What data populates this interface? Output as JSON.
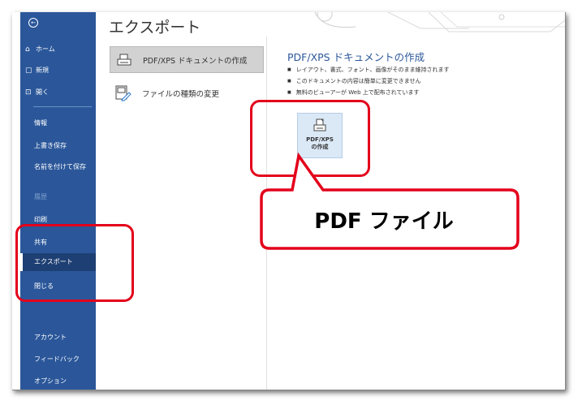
{
  "sidebar": {
    "top_items": [
      {
        "icon": "home-icon",
        "glyph": "⌂",
        "label": "ホーム"
      },
      {
        "icon": "new-file-icon",
        "glyph": "▢",
        "label": "新規"
      },
      {
        "icon": "folder-open-icon",
        "glyph": "⊡",
        "label": "開く"
      }
    ],
    "sub_items": [
      {
        "label": "情報"
      },
      {
        "label": "上書き保存"
      },
      {
        "label": "名前を付けて保存"
      },
      {
        "label": "履歴"
      },
      {
        "label": "印刷"
      },
      {
        "label": "共有"
      },
      {
        "label": "エクスポート"
      },
      {
        "label": "閉じる"
      }
    ],
    "bottom_items": [
      {
        "label": "アカウント"
      },
      {
        "label": "フィードバック"
      },
      {
        "label": "オプション"
      }
    ],
    "selected": "エクスポート",
    "disabled": "履歴"
  },
  "main": {
    "title": "エクスポート",
    "options": [
      {
        "icon": "pdf-document-icon",
        "label": "PDF/XPS ドキュメントの作成"
      },
      {
        "icon": "change-file-type-icon",
        "label": "ファイルの種類の変更"
      }
    ],
    "section_title": "PDF/XPS ドキュメントの作成",
    "bullets": [
      "レイアウト、書式、フォント、画像がそのまま維持されます",
      "このドキュメントの内容は簡単に変更できません",
      "無料のビューアーが Web 上で配布されています"
    ],
    "create_button": {
      "line1": "PDF/XPS",
      "line2": "の作成"
    }
  },
  "annotation": {
    "callout_text": "PDF ファイル",
    "color": "#e3001b"
  },
  "colors": {
    "sidebar_bg": "#2b579a",
    "sidebar_selected": "#1e3f73",
    "accent": "#2b579a"
  }
}
